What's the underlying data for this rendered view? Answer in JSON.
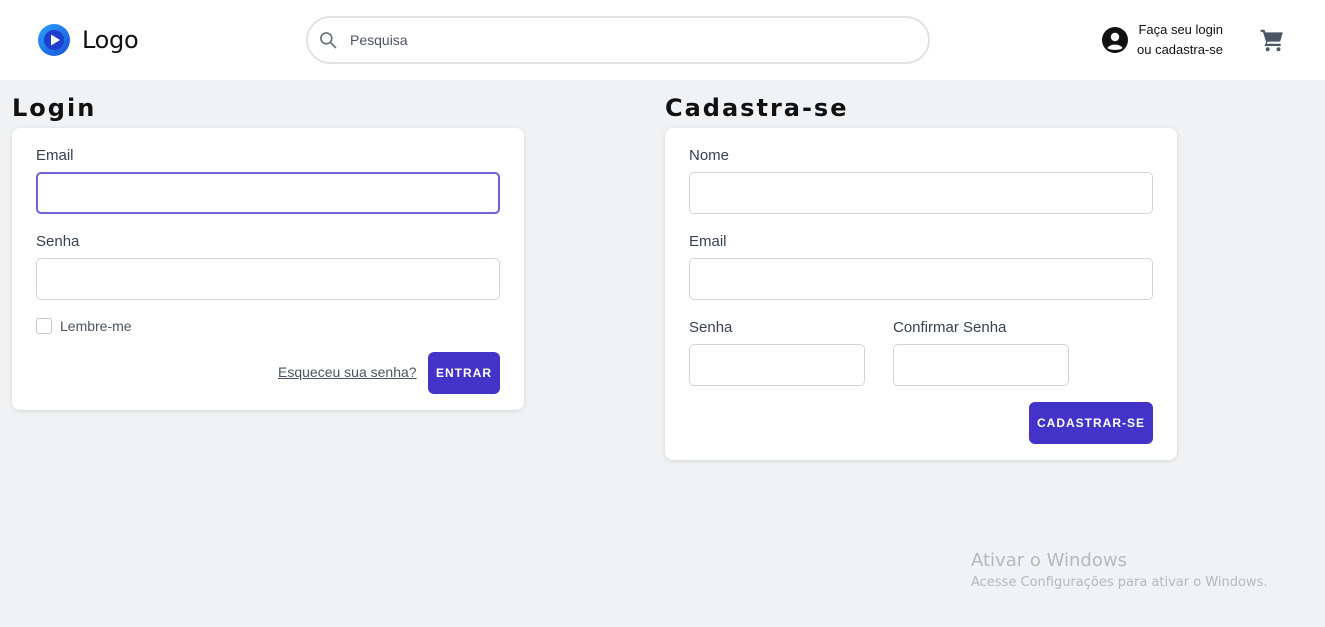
{
  "header": {
    "logo_text": "Logo",
    "logo_icon": "play-circle-icon",
    "search": {
      "placeholder": "Pesquisa",
      "value": ""
    },
    "account": {
      "line1": "Faça seu login",
      "line2_prefix": "ou ",
      "line2_link": "cadastra-se"
    },
    "cart_icon": "cart-icon"
  },
  "login": {
    "title": "Login",
    "email_label": "Email",
    "email_value": "",
    "password_label": "Senha",
    "password_value": "",
    "remember_label": "Lembre-me",
    "forgot_link": "Esqueceu sua senha?",
    "submit_label": "ENTRAR"
  },
  "register": {
    "title": "Cadastra-se",
    "name_label": "Nome",
    "name_value": "",
    "email_label": "Email",
    "email_value": "",
    "password_label": "Senha",
    "password_value": "",
    "confirm_label": "Confirmar Senha",
    "confirm_value": "",
    "submit_label": "CADASTRAR-SE"
  },
  "watermark": {
    "title": "Ativar o Windows",
    "subtitle": "Acesse Configurações para ativar o Windows."
  },
  "colors": {
    "accent": "#4433c9",
    "background": "#f1f2f4",
    "focus_border": "#6b63d6"
  }
}
